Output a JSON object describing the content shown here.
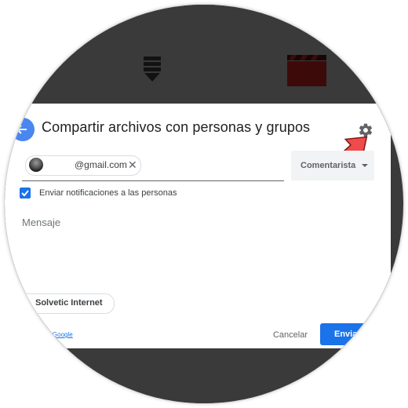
{
  "dialog": {
    "title": "Compartir archivos con personas y grupos",
    "recipient": {
      "email": "@gmail.com"
    },
    "role_select": {
      "selected": "Comentarista"
    },
    "notify": {
      "label": "Enviar notificaciones a las personas",
      "checked": true
    },
    "message": {
      "placeholder": "Mensaje"
    },
    "account": {
      "name": "Solvetic Internet"
    },
    "feedback_link": "ntarios a Google",
    "cancel_label": "Cancelar",
    "send_label": "Envia"
  },
  "icons": {
    "back": "arrow-left-icon",
    "settings": "gear-icon",
    "close": "close-icon",
    "dropdown": "caret-down-icon",
    "checkbox": "checkmark-icon",
    "annotation": "red-arrow-icon",
    "background_file_1": "download-icon",
    "background_file_2": "video-clapper-icon"
  },
  "colors": {
    "accent": "#1a73e8",
    "background_dark": "#3a3a3a",
    "annotation_arrow": "#f04a4a"
  }
}
